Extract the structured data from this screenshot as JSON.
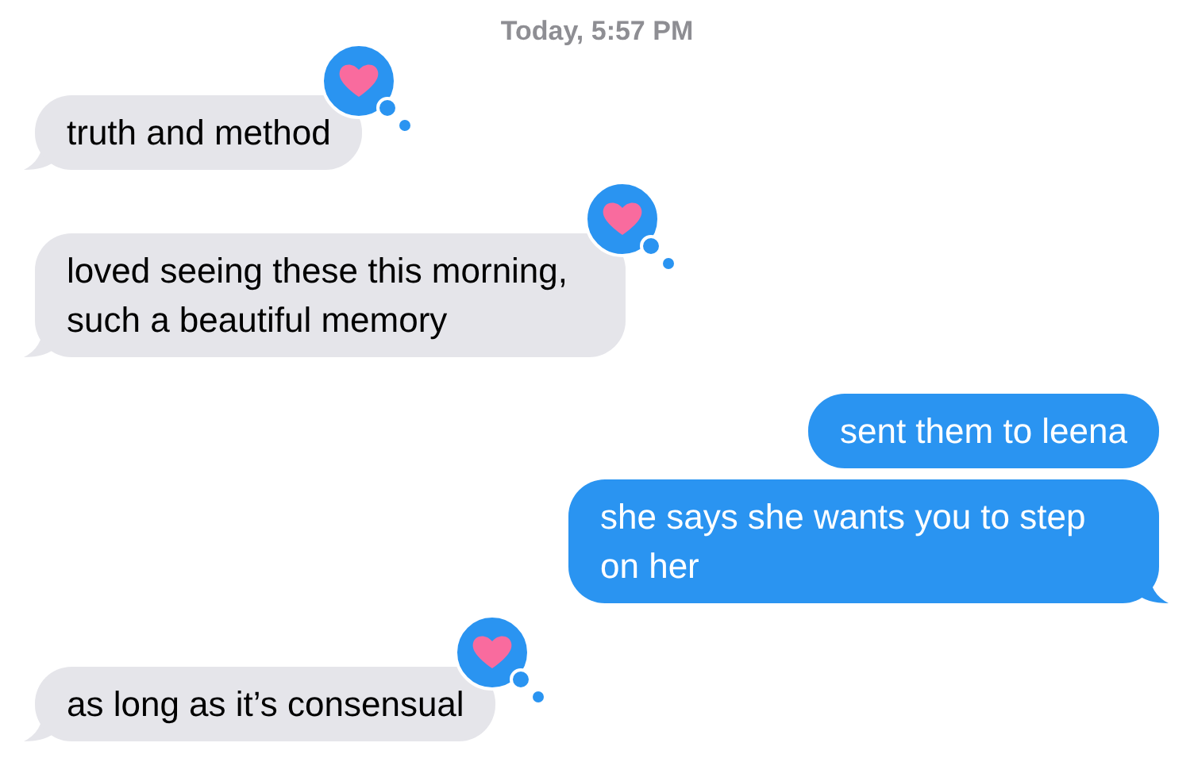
{
  "timestamp": {
    "day": "Today,",
    "time": "5:57 PM"
  },
  "messages": [
    {
      "text": "truth and method",
      "kind": "received",
      "loved": true,
      "tail": true
    },
    {
      "text": "loved seeing these this morning, such a beautiful memory",
      "kind": "received",
      "loved": true,
      "tail": true
    },
    {
      "text": "sent them to leena",
      "kind": "sent",
      "loved": false,
      "tail": false
    },
    {
      "text": "she says she wants you to step on her",
      "kind": "sent",
      "loved": false,
      "tail": true
    },
    {
      "text": "as long as it’s consensual",
      "kind": "received",
      "loved": true,
      "tail": true
    }
  ]
}
